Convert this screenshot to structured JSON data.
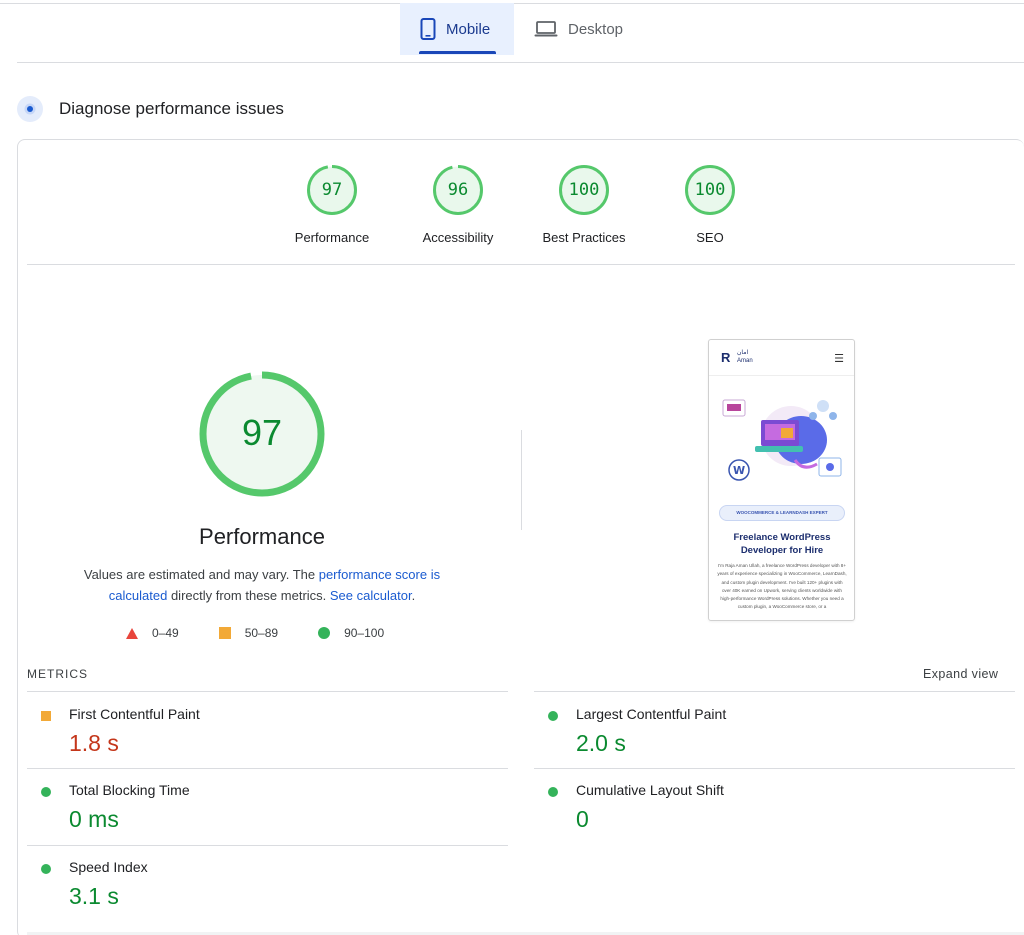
{
  "tabs": [
    {
      "label": "Mobile",
      "active": true,
      "icon": "phone-icon"
    },
    {
      "label": "Desktop",
      "active": false,
      "icon": "laptop-icon"
    }
  ],
  "section": {
    "title": "Diagnose performance issues",
    "icon": "target-icon"
  },
  "categories": [
    {
      "label": "Performance",
      "score": "97"
    },
    {
      "label": "Accessibility",
      "score": "96"
    },
    {
      "label": "Best Practices",
      "score": "100"
    },
    {
      "label": "SEO",
      "score": "100"
    }
  ],
  "main_gauge": {
    "score": "97",
    "title": "Performance",
    "note_prefix": "Values are estimated and may vary. The ",
    "note_link1": "performance score is calculated",
    "note_middle": " directly from these metrics. ",
    "note_link2": "See calculator",
    "note_suffix": "."
  },
  "legend": [
    {
      "range": "0–49",
      "shape": "triangle",
      "color": "#e8453c"
    },
    {
      "range": "50–89",
      "shape": "square",
      "color": "#f2a937"
    },
    {
      "range": "90–100",
      "shape": "circle",
      "color": "#34b35a"
    }
  ],
  "screenshot": {
    "logo": "R",
    "logo_text": "Aman",
    "logo_arabic": "امان",
    "badge": "WOOCOMMERCE & LEARNDASH EXPERT",
    "headline": "Freelance WordPress Developer for Hire",
    "paragraph": "I'm Raja Aman Ullah, a freelance WordPress developer with 8+ years of experience specializing in WooCommerce, LearnDash, and custom plugin development. I've built 120+ plugins with over 40K earned on Upwork, serving clients worldwide with high-performance WordPress solutions. Whether you need a custom plugin, a WooCommerce store, or a"
  },
  "metrics": {
    "heading": "METRICS",
    "expand_label": "Expand view",
    "items": [
      {
        "name": "First Contentful Paint",
        "value": "1.8 s",
        "status": "average"
      },
      {
        "name": "Largest Contentful Paint",
        "value": "2.0 s",
        "status": "good"
      },
      {
        "name": "Total Blocking Time",
        "value": "0 ms",
        "status": "good"
      },
      {
        "name": "Cumulative Layout Shift",
        "value": "0",
        "status": "good"
      },
      {
        "name": "Speed Index",
        "value": "3.1 s",
        "status": "good"
      }
    ]
  },
  "colors": {
    "good": "#0b8a30",
    "good_ring": "#55c86b",
    "average": "#f2a937",
    "poor_value": "#c4361a",
    "accent": "#1a47b8"
  }
}
